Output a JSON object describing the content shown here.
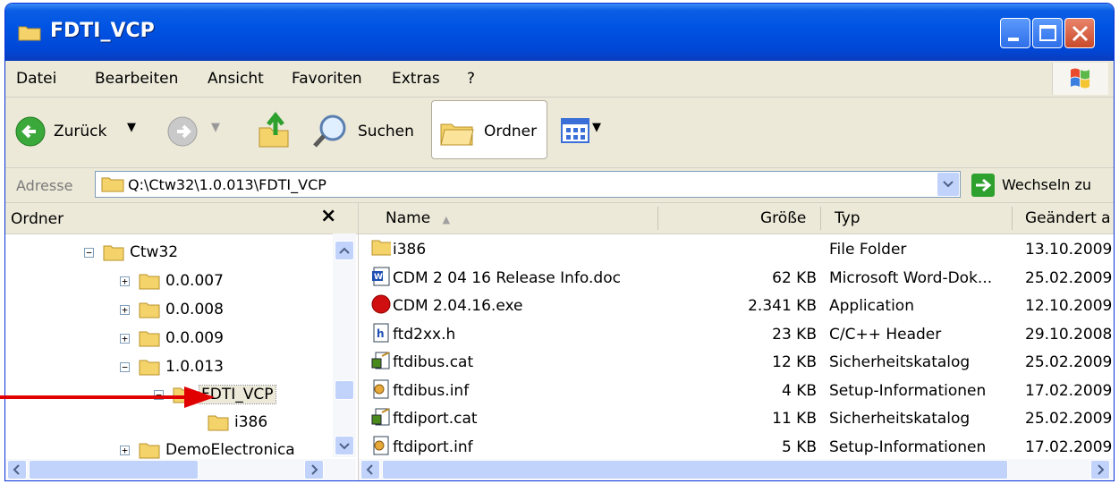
{
  "window": {
    "title": "FDTI_VCP"
  },
  "menu": [
    {
      "label": "Datei"
    },
    {
      "label": "Bearbeiten"
    },
    {
      "label": "Ansicht"
    },
    {
      "label": "Favoriten"
    },
    {
      "label": "Extras"
    },
    {
      "label": "?"
    }
  ],
  "toolbar": {
    "back_label": "Zurück",
    "search_label": "Suchen",
    "folders_label": "Ordner"
  },
  "address": {
    "label": "Adresse",
    "value": "Q:\\Ctw32\\1.0.013\\FDTI_VCP",
    "go_label": "Wechseln zu"
  },
  "folders_pane": {
    "title": "Ordner",
    "close": "×",
    "tree": [
      {
        "label": "Ctw32",
        "toggle": "−"
      },
      {
        "label": "0.0.007",
        "toggle": "+"
      },
      {
        "label": "0.0.008",
        "toggle": "+"
      },
      {
        "label": "0.0.009",
        "toggle": "+"
      },
      {
        "label": "1.0.013",
        "toggle": "−"
      },
      {
        "label": "FDTI_VCP",
        "toggle": "−"
      },
      {
        "label": "i386",
        "toggle": ""
      },
      {
        "label": "DemoElectronica",
        "toggle": "+"
      }
    ]
  },
  "file_list": {
    "columns": {
      "name": "Name",
      "size": "Größe",
      "type": "Typ",
      "modified": "Geändert a"
    },
    "rows": [
      {
        "name": "i386",
        "size": "",
        "type": "File Folder",
        "modified": "13.10.2009",
        "icon": "folder-icon"
      },
      {
        "name": "CDM 2 04 16 Release Info.doc",
        "size": "62 KB",
        "type": "Microsoft Word-Dok...",
        "modified": "25.02.2009",
        "icon": "word-doc-icon"
      },
      {
        "name": "CDM 2.04.16.exe",
        "size": "2.341 KB",
        "type": "Application",
        "modified": "12.10.2009",
        "icon": "application-icon"
      },
      {
        "name": "ftd2xx.h",
        "size": "23 KB",
        "type": "C/C++ Header",
        "modified": "29.10.2008",
        "icon": "header-file-icon"
      },
      {
        "name": "ftdibus.cat",
        "size": "12 KB",
        "type": "Sicherheitskatalog",
        "modified": "25.02.2009",
        "icon": "catalog-icon"
      },
      {
        "name": "ftdibus.inf",
        "size": "4 KB",
        "type": "Setup-Informationen",
        "modified": "17.02.2009",
        "icon": "setup-info-icon"
      },
      {
        "name": "ftdiport.cat",
        "size": "11 KB",
        "type": "Sicherheitskatalog",
        "modified": "25.02.2009",
        "icon": "catalog-icon"
      },
      {
        "name": "ftdiport.inf",
        "size": "5 KB",
        "type": "Setup-Informationen",
        "modified": "17.02.2009",
        "icon": "setup-info-icon"
      }
    ]
  },
  "colors": {
    "titlebar": "#0054e3",
    "annotation_arrow": "#e00000",
    "folder": "#f5d36b"
  }
}
